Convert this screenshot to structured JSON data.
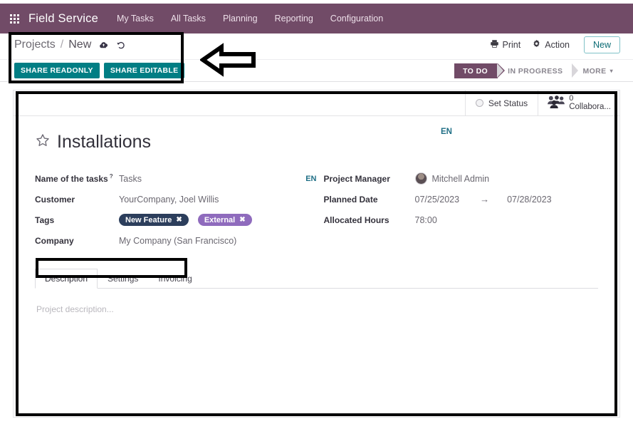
{
  "navbar": {
    "apps_icon": "apps-grid-icon",
    "brand": "Field Service",
    "items": [
      {
        "label": "My Tasks"
      },
      {
        "label": "All Tasks"
      },
      {
        "label": "Planning"
      },
      {
        "label": "Reporting"
      },
      {
        "label": "Configuration"
      }
    ],
    "background_color": "#714B67"
  },
  "control_panel": {
    "breadcrumb": {
      "root": "Projects",
      "separator": "/",
      "current": "New",
      "save_icon": "cloud-upload-icon",
      "discard_icon": "undo-arrow-icon"
    },
    "actions": [
      {
        "label": "Print",
        "icon": "printer-icon"
      },
      {
        "label": "Action",
        "icon": "gear-icon"
      }
    ],
    "new_button": "New",
    "share_buttons": [
      {
        "label": "SHARE READONLY"
      },
      {
        "label": "SHARE EDITABLE"
      }
    ],
    "share_button_color": "#017e84",
    "statusbar": {
      "stages": [
        {
          "label": "TO DO",
          "active": true
        },
        {
          "label": "IN PROGRESS",
          "active": false
        },
        {
          "label": "MORE",
          "active": false,
          "caret": "▾"
        }
      ]
    }
  },
  "sheet": {
    "header_buttons": {
      "set_status": {
        "label": "Set Status",
        "icon": "status-circle-icon"
      },
      "collaborators": {
        "count": "0",
        "label": "Collabora...",
        "icon": "people-group-icon"
      }
    },
    "title": {
      "star_icon": "star-outline-icon",
      "text": "Installations"
    },
    "translation_badge_top": "EN",
    "left_fields": [
      {
        "label": "Name of the tasks",
        "help": "?",
        "value": "Tasks",
        "lang_badge": "EN",
        "type": "text"
      },
      {
        "label": "Customer",
        "value": "YourCompany, Joel Willis",
        "type": "text"
      },
      {
        "label": "Tags",
        "type": "tags",
        "tags": [
          {
            "label": "New Feature",
            "color": "#2c3e5c",
            "remove_icon": "✖"
          },
          {
            "label": "External",
            "color": "#8f6bbd",
            "remove_icon": "✖"
          }
        ]
      },
      {
        "label": "Company",
        "value": "My Company (San Francisco)",
        "type": "text"
      }
    ],
    "right_fields": [
      {
        "label": "Project Manager",
        "value": "Mitchell Admin",
        "type": "user",
        "avatar": "user-avatar"
      },
      {
        "label": "Planned Date",
        "type": "daterange",
        "start": "07/25/2023",
        "arrow": "→",
        "end": "07/28/2023"
      },
      {
        "label": "Allocated Hours",
        "value": "78:00",
        "type": "text"
      }
    ],
    "notebook": {
      "tabs": [
        {
          "label": "Description",
          "active": true
        },
        {
          "label": "Settings",
          "active": false
        },
        {
          "label": "Invoicing",
          "active": false
        }
      ],
      "description_placeholder": "Project description..."
    }
  },
  "annotations": {
    "boxes": [
      {
        "name": "breadcrumb-and-share-highlight"
      },
      {
        "name": "form-sheet-highlight"
      },
      {
        "name": "notebook-tabs-highlight"
      }
    ],
    "arrow": {
      "name": "left-pointing-arrow",
      "direction": "left",
      "color": "#000000"
    }
  }
}
